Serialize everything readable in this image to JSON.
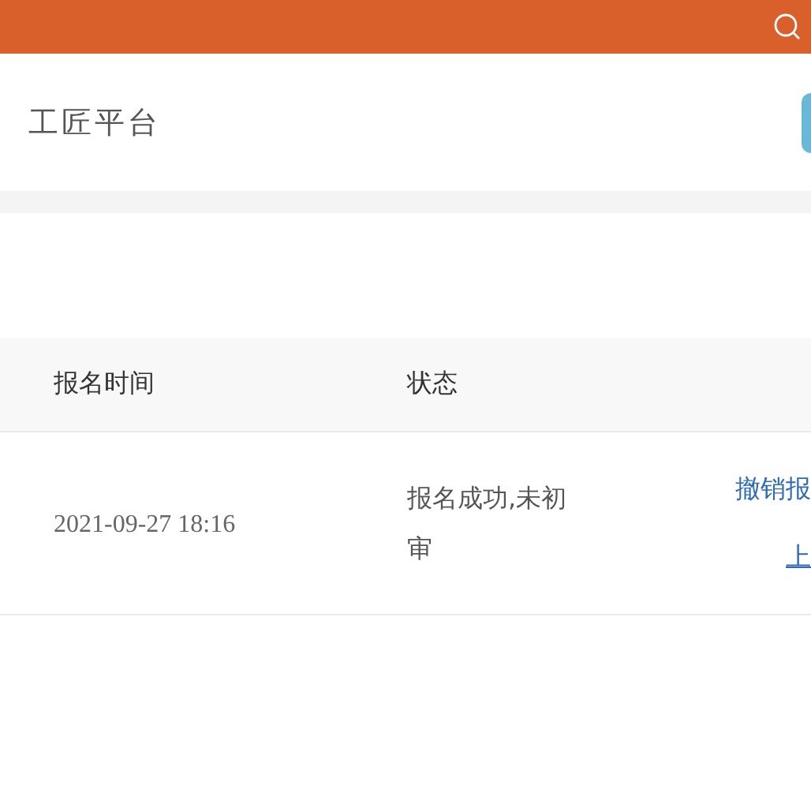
{
  "header": {
    "title": "工匠平台"
  },
  "table": {
    "columns": [
      "报名时间",
      "状态"
    ],
    "rows": [
      {
        "time": "2021-09-27 18:16",
        "status": "报名成功,未初审",
        "actions": [
          "撤销报",
          "上"
        ]
      }
    ]
  }
}
